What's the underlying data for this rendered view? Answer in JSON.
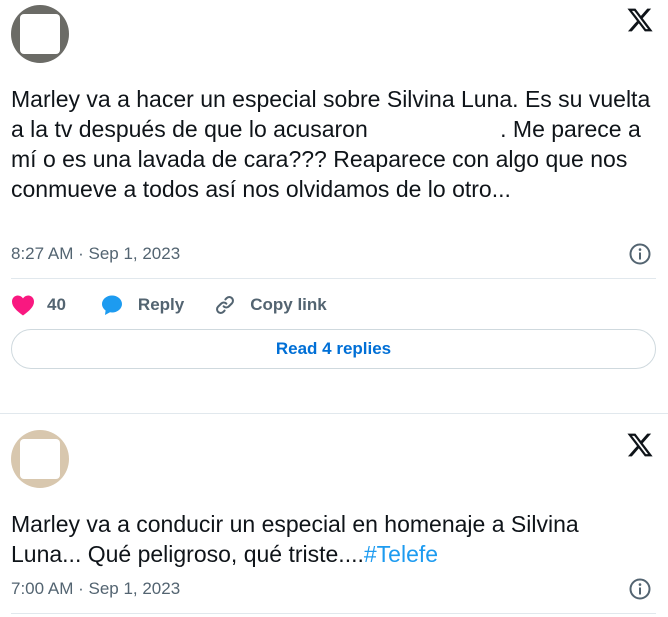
{
  "tweets": [
    {
      "avatar_icon": "avatar-photo",
      "text_before": "Marley va a hacer un especial sobre Silvina Luna. Es su vuelta a la tv después de que lo acusaron ",
      "text_after": ". Me parece a mí o es una lavada de cara??? Reaparece con algo que nos conmueve a todos así nos olvidamos de lo otro...",
      "timestamp": "8:27 AM · Sep 1, 2023",
      "likes": "40",
      "reply_label": "Reply",
      "copy_link_label": "Copy link",
      "read_replies_label": "Read 4 replies"
    },
    {
      "avatar_icon": "avatar-photo",
      "text": "Marley va a conducir un especial en homenaje a Silvina Luna... Qué peligroso, qué triste....",
      "hashtag": "#Telefe",
      "timestamp": "7:00 AM · Sep 1, 2023"
    }
  ],
  "colors": {
    "text": "#0f1419",
    "meta": "#536471",
    "like": "#f91880",
    "reply": "#1d9bf0",
    "link": "#006fd6",
    "hashtag": "#1d9bf0",
    "border": "#cfd9de"
  },
  "icons": [
    "x-logo-icon",
    "info-icon",
    "heart-icon",
    "reply-bubble-icon",
    "link-icon"
  ]
}
